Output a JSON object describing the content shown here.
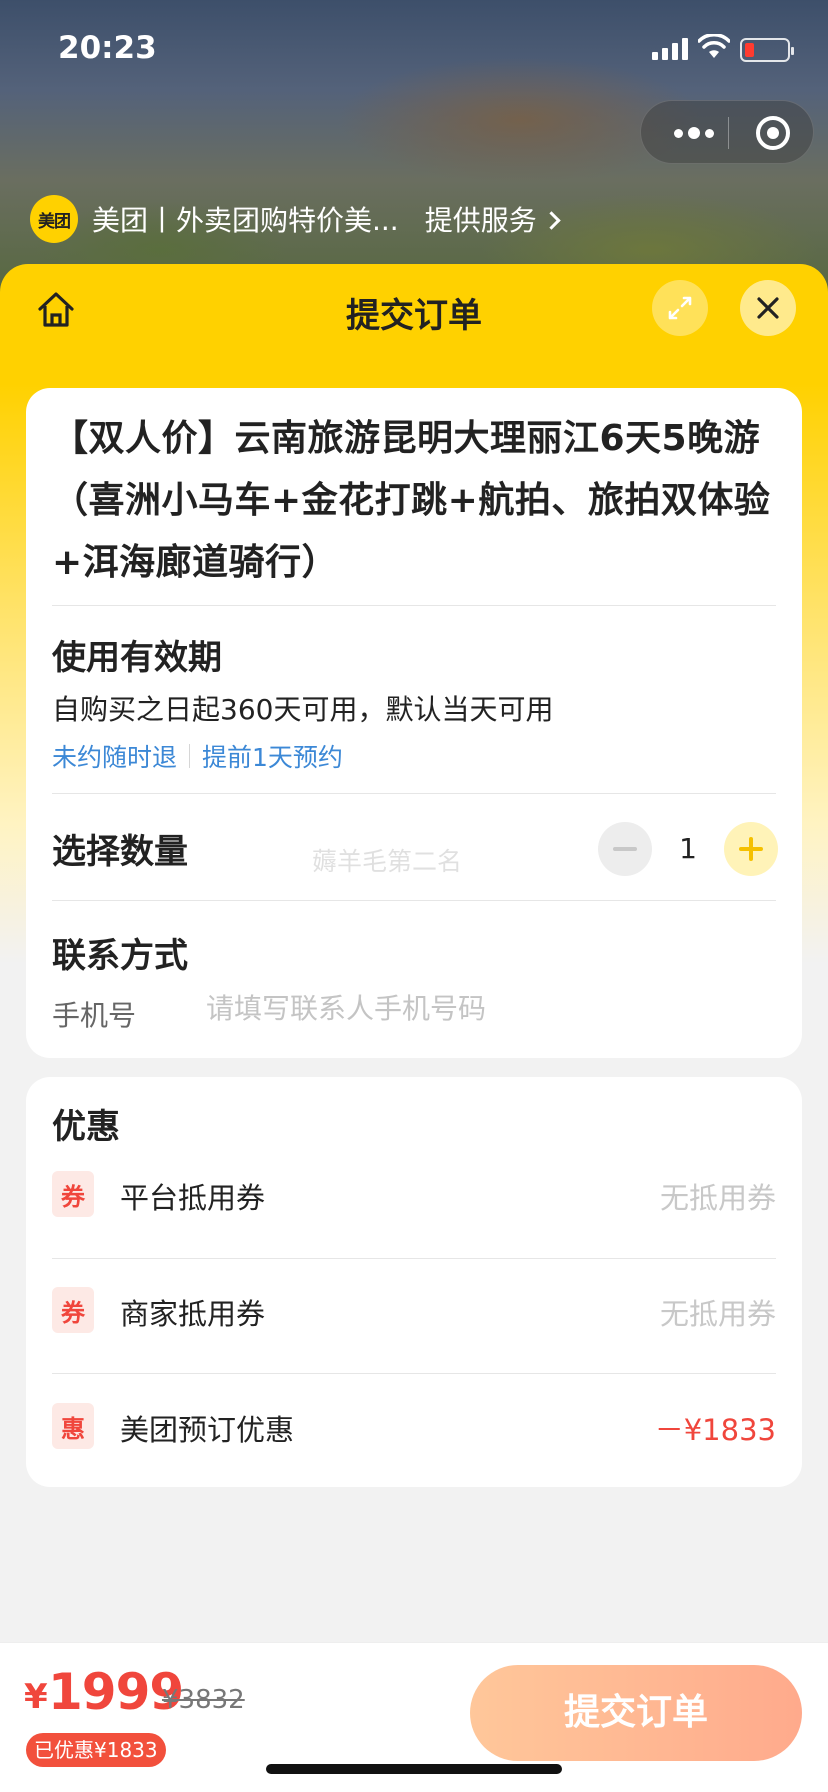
{
  "status_bar": {
    "time": "20:23"
  },
  "service_bar": {
    "logo_text": "美团",
    "app_name": "美团丨外卖团购特价美...",
    "service_link": "提供服务"
  },
  "header": {
    "title": "提交订单"
  },
  "product": {
    "title": "【双人价】云南旅游昆明大理丽江6天5晚游（喜洲小马车+金花打跳+航拍、旅拍双体验+洱海廊道骑行）"
  },
  "validity": {
    "title": "使用有效期",
    "text": "自购买之日起360天可用，默认当天可用",
    "tags": [
      "未约随时退",
      "提前1天预约"
    ]
  },
  "quantity": {
    "label": "选择数量",
    "value": "1",
    "watermark": "薅羊毛第二名"
  },
  "contact": {
    "title": "联系方式",
    "phone_label": "手机号",
    "phone_placeholder": "请填写联系人手机号码",
    "phone_value": ""
  },
  "discounts": {
    "title": "优惠",
    "items": [
      {
        "badge": "券",
        "label": "平台抵用券",
        "value": "无抵用券"
      },
      {
        "badge": "券",
        "label": "商家抵用券",
        "value": "无抵用券"
      },
      {
        "badge": "惠",
        "label": "美团预订优惠",
        "value": "－¥1833"
      }
    ]
  },
  "footer": {
    "currency": "¥",
    "price": "1999",
    "original_price": "¥3832",
    "saved": "已优惠¥1833",
    "submit_label": "提交订单"
  },
  "colors": {
    "brand_yellow": "#ffd100",
    "accent_red": "#f0463c",
    "link_blue": "#3c88d6",
    "submit_gradient_start": "#ffc79a",
    "submit_gradient_end": "#ffaa8c"
  }
}
